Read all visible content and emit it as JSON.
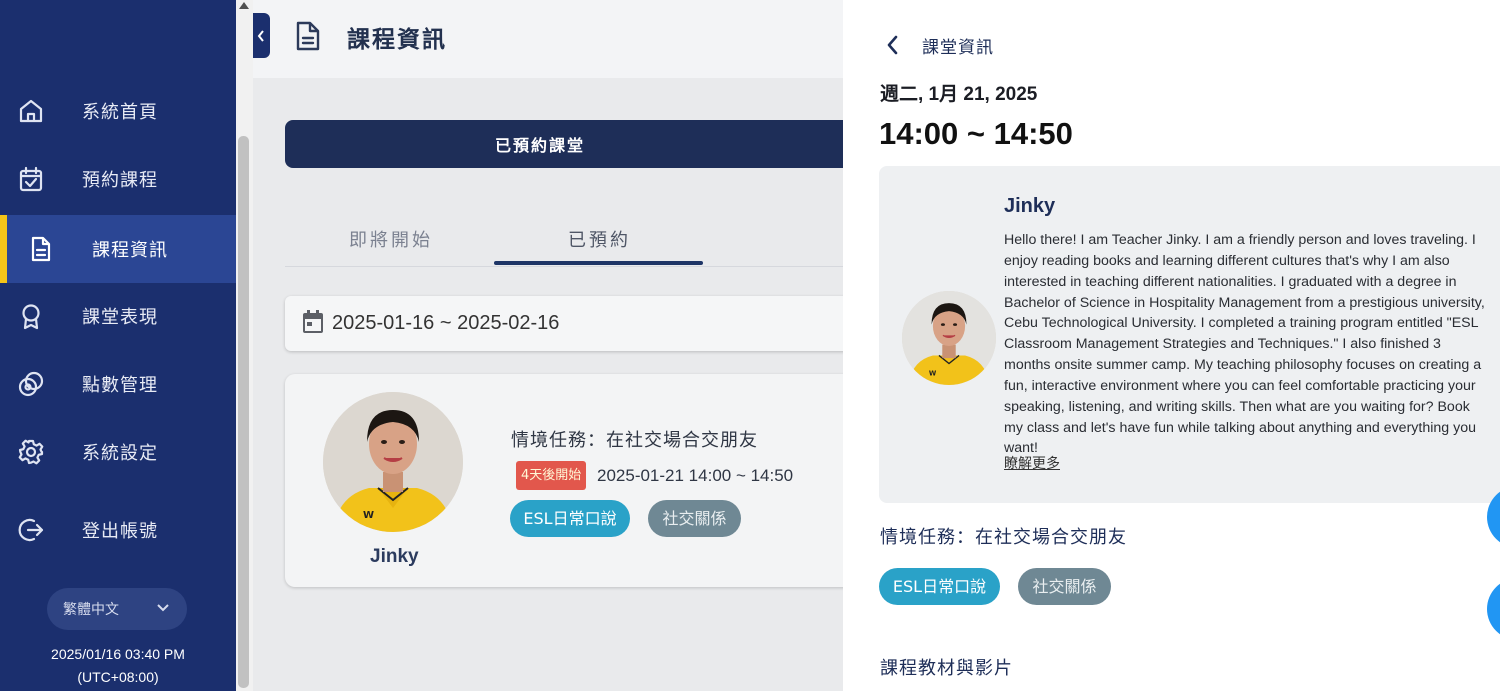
{
  "sidebar": {
    "items": [
      {
        "label": "系統首頁",
        "icon": "home-icon",
        "active": false
      },
      {
        "label": "預約課程",
        "icon": "calendar-check-icon",
        "active": false
      },
      {
        "label": "課程資訊",
        "icon": "document-icon",
        "active": true
      },
      {
        "label": "課堂表現",
        "icon": "award-icon",
        "active": false
      },
      {
        "label": "點數管理",
        "icon": "coins-icon",
        "active": false
      },
      {
        "label": "系統設定",
        "icon": "gear-icon",
        "active": false
      },
      {
        "label": "登出帳號",
        "icon": "logout-icon",
        "active": false
      }
    ],
    "language": "繁體中文",
    "datetime": "2025/01/16 03:40 PM",
    "timezone": "(UTC+08:00)"
  },
  "header": {
    "title": "課程資訊"
  },
  "main": {
    "booked_button": "已預約課堂",
    "tabs": [
      {
        "label": "即將開始",
        "active": false
      },
      {
        "label": "已預約",
        "active": true
      }
    ],
    "date_range": "2025-01-16 ~ 2025-02-16",
    "lesson_card": {
      "teacher_name": "Jinky",
      "mission": "情境任務：在社交場合交朋友",
      "badge": "4天後開始",
      "time": "2025-01-21 14:00 ~ 14:50",
      "tags": [
        "ESL日常口說",
        "社交關係"
      ]
    }
  },
  "panel": {
    "title": "課堂資訊",
    "date": "週二, 1月 21, 2025",
    "time": "14:00 ~ 14:50",
    "teacher": {
      "name": "Jinky",
      "bio": "Hello there! I am Teacher Jinky. I am a friendly person and loves traveling. I enjoy reading books and learning different cultures that's why I am also interested in teaching different nationalities. I graduated with a degree in Bachelor of Science in Hospitality Management from a prestigious university, Cebu Technological University. I completed a training program entitled \"ESL Classroom Management Strategies and Techniques.\" I also finished 3 months onsite summer camp. My teaching philosophy focuses on creating a fun, interactive environment where you can feel comfortable practicing your speaking, listening, and writing skills. Then what are you waiting for? Book my class and let's have fun while talking about anything and everything you want!",
      "more": "瞭解更多"
    },
    "mission": "情境任務：在社交場合交朋友",
    "tags": [
      "ESL日常口說",
      "社交關係"
    ],
    "materials_heading": "課程教材與影片"
  },
  "colors": {
    "sidebar_bg": "#1b2f6e",
    "active_bar": "#f5c518",
    "primary_dark": "#1e2e58",
    "tag_blue": "#2aa2c8",
    "tag_gray": "#6f8894",
    "badge_red": "#e2574c"
  }
}
